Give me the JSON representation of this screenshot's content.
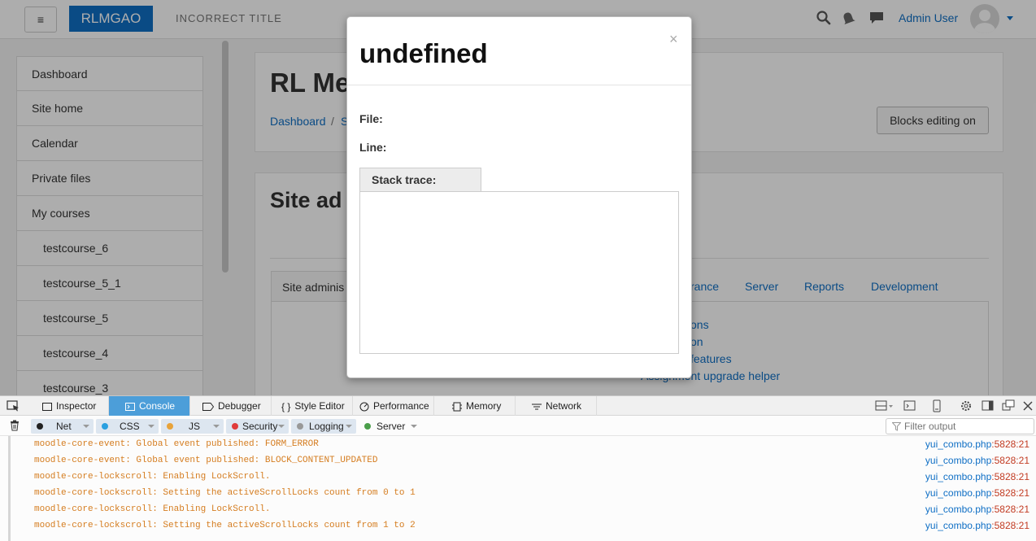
{
  "navbar": {
    "menu_glyph": "≡",
    "brand": "RLMGAO",
    "title": "INCORRECT TITLE",
    "icons": [
      "search-icon",
      "bell-icon",
      "message-icon"
    ],
    "user": "Admin User"
  },
  "sidebar": {
    "items": [
      {
        "label": "Dashboard"
      },
      {
        "label": "Site home"
      },
      {
        "label": "Calendar"
      },
      {
        "label": "Private files"
      },
      {
        "label": "My courses"
      },
      {
        "label": "testcourse_6"
      },
      {
        "label": "testcourse_5_1"
      },
      {
        "label": "testcourse_5"
      },
      {
        "label": "testcourse_4"
      },
      {
        "label": "testcourse_3"
      }
    ]
  },
  "main": {
    "heading": "RL Me",
    "breadcrumb": [
      "Dashboard",
      "S"
    ],
    "breadcrumb_sep": "/",
    "blocks_button": "Blocks editing on",
    "section_heading": "Site ad",
    "tabs": {
      "active": "Site adminis",
      "links": [
        "rance",
        "Server",
        "Reports",
        "Development"
      ]
    },
    "panel_links": [
      "ons",
      "on",
      "features",
      "Assignment upgrade helper"
    ]
  },
  "modal": {
    "title": "undefined",
    "close": "×",
    "file_label": "File:",
    "line_label": "Line:",
    "stack_tab": "Stack trace:"
  },
  "devtools": {
    "tabs": [
      {
        "label": "Inspector",
        "icon": "inspector-icon"
      },
      {
        "label": "Console",
        "icon": "console-icon",
        "active": true
      },
      {
        "label": "Debugger",
        "icon": "debugger-icon"
      },
      {
        "label": "Style Editor",
        "icon": "style-editor-icon"
      },
      {
        "label": "Performance",
        "icon": "performance-icon"
      },
      {
        "label": "Memory",
        "icon": "memory-icon"
      },
      {
        "label": "Network",
        "icon": "network-icon"
      }
    ],
    "filters": [
      {
        "label": "Net",
        "color": "#222222"
      },
      {
        "label": "CSS",
        "color": "#2aa0e0"
      },
      {
        "label": "JS",
        "color": "#e8a33a"
      },
      {
        "label": "Security",
        "color": "#e03a3a"
      },
      {
        "label": "Logging",
        "color": "#999999"
      },
      {
        "label": "Server",
        "color": "#4a9e4a"
      }
    ],
    "filter_placeholder": "Filter output",
    "log": [
      {
        "msg": "moodle-core-event: Global event published: FORM_ERROR",
        "file": "yui_combo.php",
        "line": ":5828:21"
      },
      {
        "msg": "moodle-core-event: Global event published: BLOCK_CONTENT_UPDATED",
        "file": "yui_combo.php",
        "line": ":5828:21"
      },
      {
        "msg": "moodle-core-lockscroll: Enabling LockScroll.",
        "file": "yui_combo.php",
        "line": ":5828:21"
      },
      {
        "msg": "moodle-core-lockscroll: Setting the activeScrollLocks count from 0 to 1",
        "file": "yui_combo.php",
        "line": ":5828:21"
      },
      {
        "msg": "moodle-core-lockscroll: Enabling LockScroll.",
        "file": "yui_combo.php",
        "line": ":5828:21"
      },
      {
        "msg": "moodle-core-lockscroll: Setting the activeScrollLocks count from 1 to 2",
        "file": "yui_combo.php",
        "line": ":5828:21"
      }
    ]
  },
  "colors": {
    "brand": "#0f6fc5",
    "link": "#0f6fc5",
    "devtools_active_tab": "#4c9ed9",
    "log_text": "#d57d20"
  }
}
